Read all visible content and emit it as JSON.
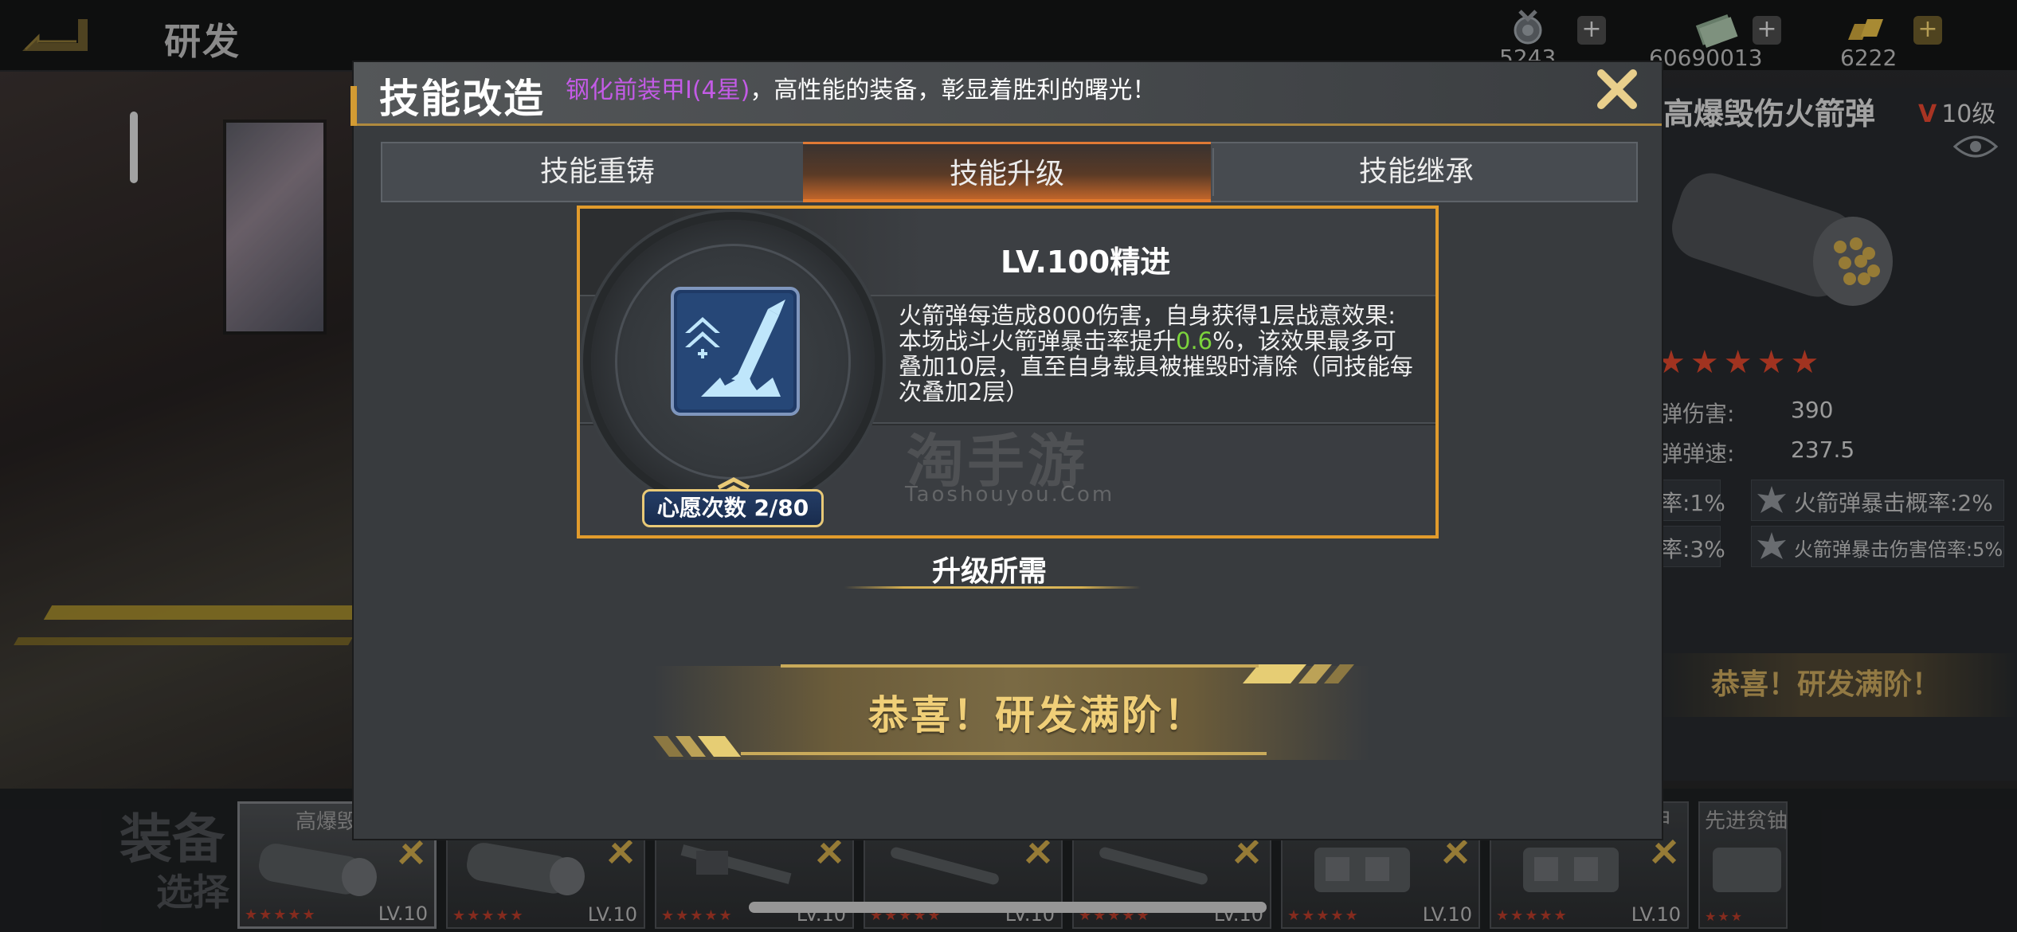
{
  "header": {
    "title": "研发",
    "resources": [
      {
        "icon": "medal-icon",
        "value": "5243"
      },
      {
        "icon": "cash-icon",
        "value": "60690013"
      },
      {
        "icon": "gold-icon",
        "value": "6222"
      }
    ]
  },
  "modal": {
    "title": "技能改造",
    "marquee": {
      "highlight": "钢化前装甲I(4星)",
      "text": "，高性能的装备，彰显着胜利的曙光！"
    },
    "tabs": [
      {
        "label": "技能重铸",
        "active": false
      },
      {
        "label": "技能升级",
        "active": true
      },
      {
        "label": "技能继承",
        "active": false
      }
    ],
    "skill": {
      "title": "LV.100精进",
      "desc_before": "火箭弹每造成8000伤害，自身获得1层战意效果:本场战斗火箭弹暴击率提升",
      "desc_value": "0.6",
      "desc_after": "%，该效果最多可叠加10层，直至自身载具被摧毁时清除（同技能每次叠加2层）",
      "wish_label": "心愿次数 2/80"
    },
    "requirements_title": "升级所需",
    "banner": "恭喜！研发满阶！",
    "watermark": "淘手游",
    "watermark_sub": "Taoshouyou.Com"
  },
  "right_panel": {
    "title": "高爆毁伤火箭弹",
    "level_prefix": "V",
    "level": "10级",
    "stars": "★★★★★",
    "stats": [
      {
        "label": "弹伤害:",
        "value": "390"
      },
      {
        "label": "弹弹速:",
        "value": "237.5"
      }
    ],
    "bonuses": [
      {
        "left": "率:1%",
        "right": "火箭弹暴击概率:2%"
      },
      {
        "left": "率:3%",
        "right": "火箭弹暴击伤害倍率:5%"
      }
    ],
    "done": "恭喜！研发满阶！"
  },
  "equipment": {
    "label": "装备",
    "label2": "选择",
    "slots": [
      {
        "name": "高爆毁",
        "lv": "LV.10",
        "selected": true
      },
      {
        "name": "",
        "lv": "LV.10",
        "selected": false
      },
      {
        "name": "",
        "lv": "LV.10",
        "selected": false
      },
      {
        "name": "",
        "lv": "LV.10",
        "selected": false
      },
      {
        "name": "",
        "lv": "LV.10",
        "selected": false
      },
      {
        "name": "",
        "lv": "LV.10",
        "selected": false
      },
      {
        "name": "甲",
        "lv": "LV.10",
        "selected": false
      },
      {
        "name": "先进贫铀",
        "lv": "",
        "selected": false
      }
    ]
  },
  "colors": {
    "accent_orange": "#e27a2c",
    "card_border": "#e19b2c",
    "highlight_purple": "#c35be6",
    "value_green": "#7cd43c",
    "banner_gold": "#f0cf78"
  }
}
